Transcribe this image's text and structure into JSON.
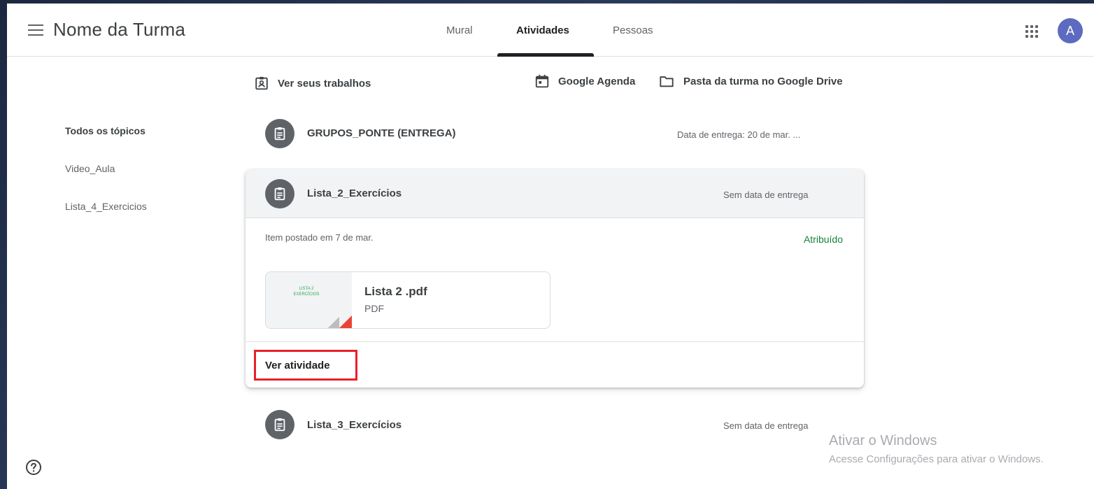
{
  "header": {
    "class_name": "Nome da Turma",
    "tabs": [
      {
        "label": "Mural"
      },
      {
        "label": "Atividades"
      },
      {
        "label": "Pessoas"
      }
    ],
    "active_tab": "Atividades",
    "avatar_initial": "A"
  },
  "actions": {
    "your_work": "Ver seus trabalhos",
    "calendar": "Google Agenda",
    "drive_folder": "Pasta da turma no Google Drive"
  },
  "topics": [
    {
      "label": "Todos os tópicos",
      "active": true
    },
    {
      "label": "Video_Aula",
      "active": false
    },
    {
      "label": "Lista_4_Exercicios",
      "active": false
    }
  ],
  "assignments": [
    {
      "title": "GRUPOS_PONTE (ENTREGA)",
      "due": "Data de entrega: 20 de mar. ..."
    },
    {
      "title": "Lista_2_Exercícios",
      "due": "Sem data de entrega",
      "expanded": true,
      "posted": "Item postado em 7 de mar.",
      "status": "Atribuído",
      "attachment": {
        "name": "Lista 2 .pdf",
        "type": "PDF",
        "thumb_line1": "LISTA 2",
        "thumb_line2": "EXERCÍCIOS"
      },
      "view_label": "Ver atividade"
    },
    {
      "title": "Lista_3_Exercícios",
      "due": "Sem data de entrega"
    }
  ],
  "watermark": {
    "line1": "Ativar o Windows",
    "line2": "Acesse Configurações para ativar o Windows."
  },
  "icons": {
    "menu": "hamburger-menu-icon",
    "apps": "apps-grid-icon",
    "assignment": "assignment-clipboard-icon",
    "help": "help-circle-icon"
  },
  "colors": {
    "avatar": "#5c6bc0",
    "status_assigned": "#188038",
    "highlight_box": "#e8202a",
    "pdf_corner": "#ea4335"
  }
}
